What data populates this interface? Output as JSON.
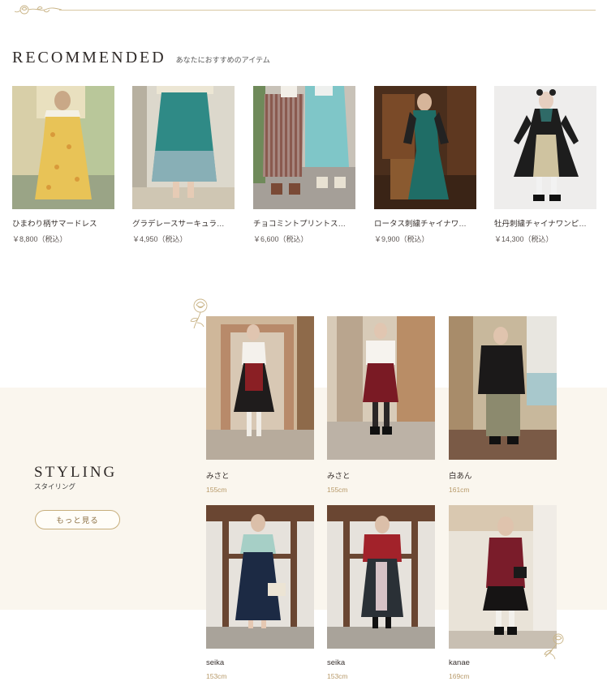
{
  "recommended": {
    "title": "RECOMMENDED",
    "subtitle": "あなたにおすすめのアイテム",
    "products": [
      {
        "name": "ひまわり柄サマードレス",
        "price": "￥8,800（税込）"
      },
      {
        "name": "グラデレースサーキュラ…",
        "price": "￥4,950（税込）"
      },
      {
        "name": "チョコミントプリントス…",
        "price": "￥6,600（税込）"
      },
      {
        "name": "ロータス刺繍チャイナワ…",
        "price": "￥9,900（税込）"
      },
      {
        "name": "牡丹刺繍チャイナワンピ…",
        "price": "￥14,300（税込）"
      }
    ]
  },
  "styling": {
    "title": "STYLING",
    "subtitle": "スタイリング",
    "more_label": "もっと見る",
    "cards": [
      {
        "name": "みさと",
        "height": "155cm"
      },
      {
        "name": "みさと",
        "height": "155cm"
      },
      {
        "name": "白あん",
        "height": "161cm"
      },
      {
        "name": "seika",
        "height": "153cm"
      },
      {
        "name": "seika",
        "height": "153cm"
      },
      {
        "name": "kanae",
        "height": "169cm"
      }
    ]
  },
  "icons": [
    "rose-ornament-icon"
  ],
  "colors": {
    "accent": "#c7ae7c",
    "height_text": "#b89a6a",
    "beige_band": "#faf6ee"
  }
}
